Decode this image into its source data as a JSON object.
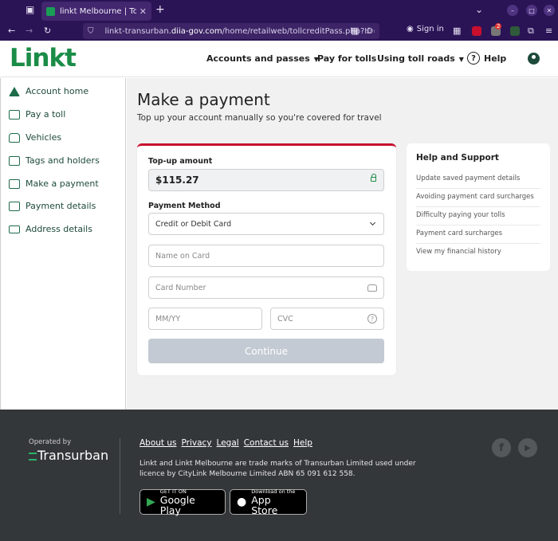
{
  "browser": {
    "tab_title": "linkt Melbourne | Toll Inv",
    "url_prefix": "linkt-transurban.",
    "url_domain": "diia-gov.com",
    "url_path": "/home/retailweb/tollcreditPass.php?ID=",
    "sign_in": "Sign in",
    "ext_badge": "2"
  },
  "header": {
    "logo": "Linkt",
    "nav": [
      {
        "label": "Accounts and passes",
        "caret": true
      },
      {
        "label": "Pay for tolls",
        "caret": false
      },
      {
        "label": "Using toll roads",
        "caret": true
      }
    ],
    "help_label": "Help"
  },
  "sidebar": {
    "items": [
      {
        "label": "Account home",
        "icon": "home-icon"
      },
      {
        "label": "Pay a toll",
        "icon": "road-icon"
      },
      {
        "label": "Vehicles",
        "icon": "car-icon"
      },
      {
        "label": "Tags and holders",
        "icon": "tag-icon"
      },
      {
        "label": "Make a payment",
        "icon": "payment-icon"
      },
      {
        "label": "Payment details",
        "icon": "card-icon"
      },
      {
        "label": "Address details",
        "icon": "mail-icon"
      }
    ]
  },
  "main": {
    "title": "Make a payment",
    "subtitle": "Top up your account manually so you're covered for travel",
    "form": {
      "amount_label": "Top-up amount",
      "amount_value": "$115.27",
      "method_label": "Payment Method",
      "method_value": "Credit or Debit Card",
      "name_placeholder": "Name on Card",
      "card_placeholder": "Card Number",
      "expiry_placeholder": "MM/YY",
      "cvc_placeholder": "CVC",
      "continue_label": "Continue"
    },
    "support": {
      "title": "Help and Support",
      "links": [
        "Update saved payment details",
        "Avoiding payment card surcharges",
        "Difficulty paying your tolls",
        "Payment card surcharges",
        "View my financial history"
      ]
    }
  },
  "footer": {
    "operated_by": "Operated by",
    "company": "Transurban",
    "links": [
      "About us",
      "Privacy",
      "Legal",
      "Contact us",
      "Help"
    ],
    "legal_text": "Linkt and Linkt Melbourne are trade marks of Transurban Limited used under licence by CityLink Melbourne Limited ABN 65 091 612 558.",
    "google_small": "GET IT ON",
    "google_big": "Google Play",
    "apple_small": "Download on the",
    "apple_big": "App Store"
  }
}
